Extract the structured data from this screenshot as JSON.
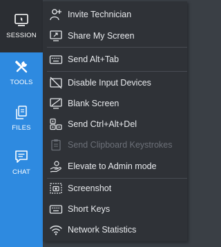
{
  "sidebar": {
    "items": [
      {
        "label": "SESSION",
        "icon": "session-icon",
        "active": true
      },
      {
        "label": "TOOLS",
        "icon": "tools-icon",
        "active": false
      },
      {
        "label": "FILES",
        "icon": "files-icon",
        "active": false
      },
      {
        "label": "CHAT",
        "icon": "chat-icon",
        "active": false
      }
    ]
  },
  "menu": {
    "items": [
      {
        "label": "Invite Technician",
        "icon": "invite-user-icon",
        "enabled": true
      },
      {
        "label": "Share My Screen",
        "icon": "share-screen-icon",
        "enabled": true
      },
      {
        "label": "Send Alt+Tab",
        "icon": "keyboard-icon",
        "enabled": true
      },
      {
        "label": "Disable Input Devices",
        "icon": "disable-input-icon",
        "enabled": true
      },
      {
        "label": "Blank Screen",
        "icon": "blank-screen-icon",
        "enabled": true
      },
      {
        "label": "Send Ctrl+Alt+Del",
        "icon": "ctrl-alt-del-icon",
        "enabled": true
      },
      {
        "label": "Send Clipboard Keystrokes",
        "icon": "clipboard-icon",
        "enabled": false
      },
      {
        "label": "Elevate to Admin mode",
        "icon": "elevate-hand-icon",
        "enabled": true
      },
      {
        "label": "Screenshot",
        "icon": "screenshot-icon",
        "enabled": true
      },
      {
        "label": "Short Keys",
        "icon": "keyboard-icon",
        "enabled": true
      },
      {
        "label": "Network Statistics",
        "icon": "wifi-icon",
        "enabled": true
      }
    ]
  },
  "colors": {
    "sidebar": "#2e8ae0",
    "active_tab": "#2b2e33",
    "menu_bg": "#2f3237",
    "text": "#e8eaed",
    "disabled_text": "#6c7078"
  }
}
